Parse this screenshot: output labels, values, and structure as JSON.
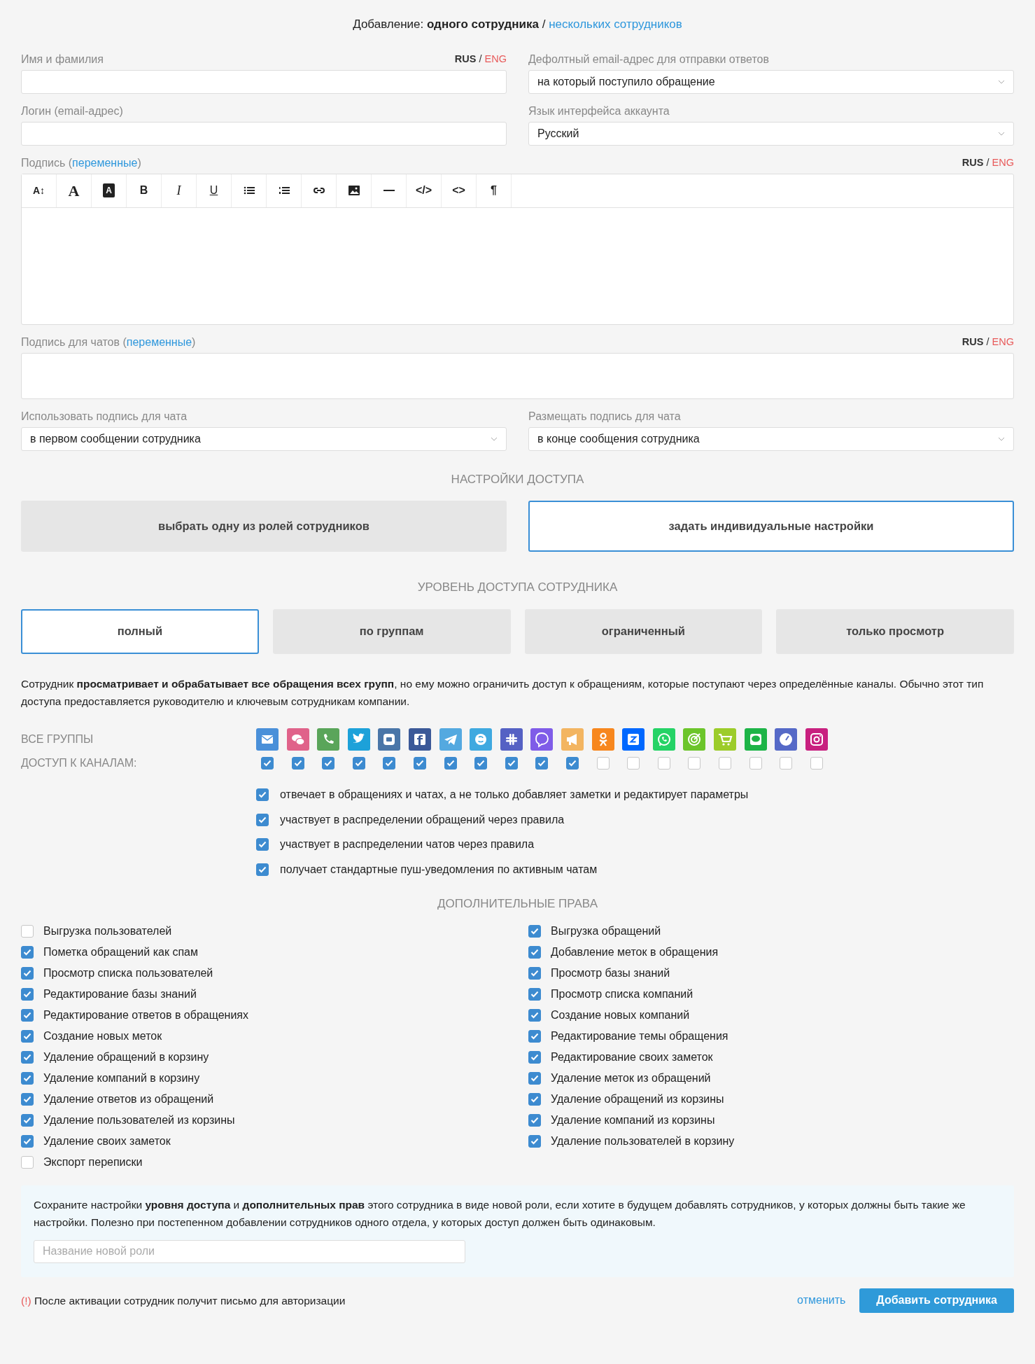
{
  "header": {
    "prefix": "Добавление:",
    "current": "одного сотрудника",
    "separator": "/",
    "link": "нескольких сотрудников"
  },
  "name_field": {
    "label": "Имя и фамилия",
    "lang_rus": "RUS",
    "lang_sep": "/",
    "lang_eng": "ENG"
  },
  "reply_email": {
    "label": "Дефолтный email-адрес для отправки ответов",
    "value": "на который поступило обращение"
  },
  "login_field": {
    "label": "Логин (email-адрес)"
  },
  "language": {
    "label": "Язык интерфейса аккаунта",
    "value": "Русский"
  },
  "signature": {
    "label": "Подпись",
    "open": "(",
    "link": "переменные",
    "close": ")",
    "lang_rus": "RUS",
    "lang_sep": "/",
    "lang_eng": "ENG",
    "toolbar": [
      {
        "kind": "size",
        "label": "A↕"
      },
      {
        "kind": "serif",
        "label": "A"
      },
      {
        "kind": "inverse",
        "label": "A"
      },
      {
        "kind": "bold",
        "label": "B"
      },
      {
        "kind": "italic",
        "label": "I"
      },
      {
        "kind": "underline",
        "label": "U"
      },
      {
        "kind": "bullets"
      },
      {
        "kind": "numbers"
      },
      {
        "kind": "link"
      },
      {
        "kind": "image"
      },
      {
        "kind": "rule"
      },
      {
        "kind": "bold",
        "label": "</>"
      },
      {
        "kind": "bold",
        "label": "<>"
      },
      {
        "kind": "bold",
        "label": "¶"
      }
    ]
  },
  "chat_signature": {
    "label": "Подпись для чатов",
    "open": "(",
    "link": "переменные",
    "close": ")",
    "lang_rus": "RUS",
    "lang_sep": "/",
    "lang_eng": "ENG"
  },
  "use_chat_signature": {
    "label": "Использовать подпись для чата",
    "value": "в первом сообщении сотрудника"
  },
  "place_chat_signature": {
    "label": "Размещать подпись для чата",
    "value": "в конце сообщения сотрудника"
  },
  "access_title": "НАСТРОЙКИ ДОСТУПА",
  "access_modes": [
    {
      "label": "выбрать одну из ролей сотрудников",
      "selected": false
    },
    {
      "label": "задать индивидуальные настройки",
      "selected": true
    }
  ],
  "level_title": "УРОВЕНЬ ДОСТУПА СОТРУДНИКА",
  "levels": [
    {
      "label": "полный",
      "selected": true
    },
    {
      "label": "по группам",
      "selected": false
    },
    {
      "label": "ограниченный",
      "selected": false
    },
    {
      "label": "только просмотр",
      "selected": false
    }
  ],
  "level_description": "Сотрудник **просматривает и обрабатывает все обращения всех групп**, но ему можно ограничить доступ к обращениям, которые поступают через определённые каналы. Обычно этот тип доступа предоставляется руководителю и ключевым сотрудникам компании.",
  "groups_label": "ВСЕ ГРУППЫ",
  "channels_label": "ДОСТУП К КАНАЛАМ:",
  "channels": [
    {
      "color": "#4a90d9",
      "checked": true
    },
    {
      "color": "#e0628a",
      "checked": true
    },
    {
      "color": "#5aa55a",
      "checked": true
    },
    {
      "color": "#1da1d9",
      "checked": true
    },
    {
      "color": "#4a76a8",
      "checked": true
    },
    {
      "color": "#3b5998",
      "checked": true
    },
    {
      "color": "#54a9e0",
      "checked": true
    },
    {
      "color": "#3fa9e0",
      "checked": true
    },
    {
      "color": "#5561c4",
      "checked": true
    },
    {
      "color": "#7f5ce8",
      "checked": true
    },
    {
      "color": "#f3b561",
      "checked": true
    },
    {
      "color": "#f7871e",
      "checked": false
    },
    {
      "color": "#0068ff",
      "checked": false
    },
    {
      "color": "#25d366",
      "checked": false
    },
    {
      "color": "#6cc52b",
      "checked": false
    },
    {
      "color": "#9ccc2a",
      "checked": false
    },
    {
      "color": "#1db447",
      "checked": false
    },
    {
      "color": "#5569c7",
      "checked": false
    },
    {
      "color": "#c8207f",
      "checked": false
    }
  ],
  "options": [
    {
      "label": "отвечает в обращениях и чатах, а не только добавляет заметки и редактирует параметры",
      "checked": true
    },
    {
      "label": "участвует в распределении обращений через правила",
      "checked": true
    },
    {
      "label": "участвует в распределении чатов через правила",
      "checked": true
    },
    {
      "label": "получает стандартные пуш-уведомления по активным чатам",
      "checked": true
    }
  ],
  "extra_title": "ДОПОЛНИТЕЛЬНЫЕ ПРАВА",
  "rights_left": [
    {
      "label": "Выгрузка пользователей",
      "checked": false
    },
    {
      "label": "Пометка обращений как спам",
      "checked": true
    },
    {
      "label": "Просмотр списка пользователей",
      "checked": true
    },
    {
      "label": "Редактирование базы знаний",
      "checked": true
    },
    {
      "label": "Редактирование ответов в обращениях",
      "checked": true
    },
    {
      "label": "Создание новых меток",
      "checked": true
    },
    {
      "label": "Удаление обращений в корзину",
      "checked": true
    },
    {
      "label": "Удаление компаний в корзину",
      "checked": true
    },
    {
      "label": "Удаление ответов из обращений",
      "checked": true
    },
    {
      "label": "Удаление пользователей из корзины",
      "checked": true
    },
    {
      "label": "Удаление своих заметок",
      "checked": true
    },
    {
      "label": "Экспорт переписки",
      "checked": false
    }
  ],
  "rights_right": [
    {
      "label": "Выгрузка обращений",
      "checked": true
    },
    {
      "label": "Добавление меток в обращения",
      "checked": true
    },
    {
      "label": "Просмотр базы знаний",
      "checked": true
    },
    {
      "label": "Просмотр списка компаний",
      "checked": true
    },
    {
      "label": "Создание новых компаний",
      "checked": true
    },
    {
      "label": "Редактирование темы обращения",
      "checked": true
    },
    {
      "label": "Редактирование своих заметок",
      "checked": true
    },
    {
      "label": "Удаление меток из обращений",
      "checked": true
    },
    {
      "label": "Удаление обращений из корзины",
      "checked": true
    },
    {
      "label": "Удаление компаний из корзины",
      "checked": true
    },
    {
      "label": "Удаление пользователей в корзину",
      "checked": true
    }
  ],
  "save_role": {
    "text": "Сохраните настройки **уровня доступа** и **дополнительных прав** этого сотрудника в виде новой роли, если хотите в будущем добавлять сотрудников, у которых должны быть такие же настройки. Полезно при постепенном добавлении сотрудников одного отдела, у которых доступ должен быть одинаковым.",
    "placeholder": "Название новой роли"
  },
  "notice": {
    "mark": "(!)",
    "text": "После активации сотрудник получит письмо для авторизации"
  },
  "cancel": "отменить",
  "submit": "Добавить сотрудника"
}
